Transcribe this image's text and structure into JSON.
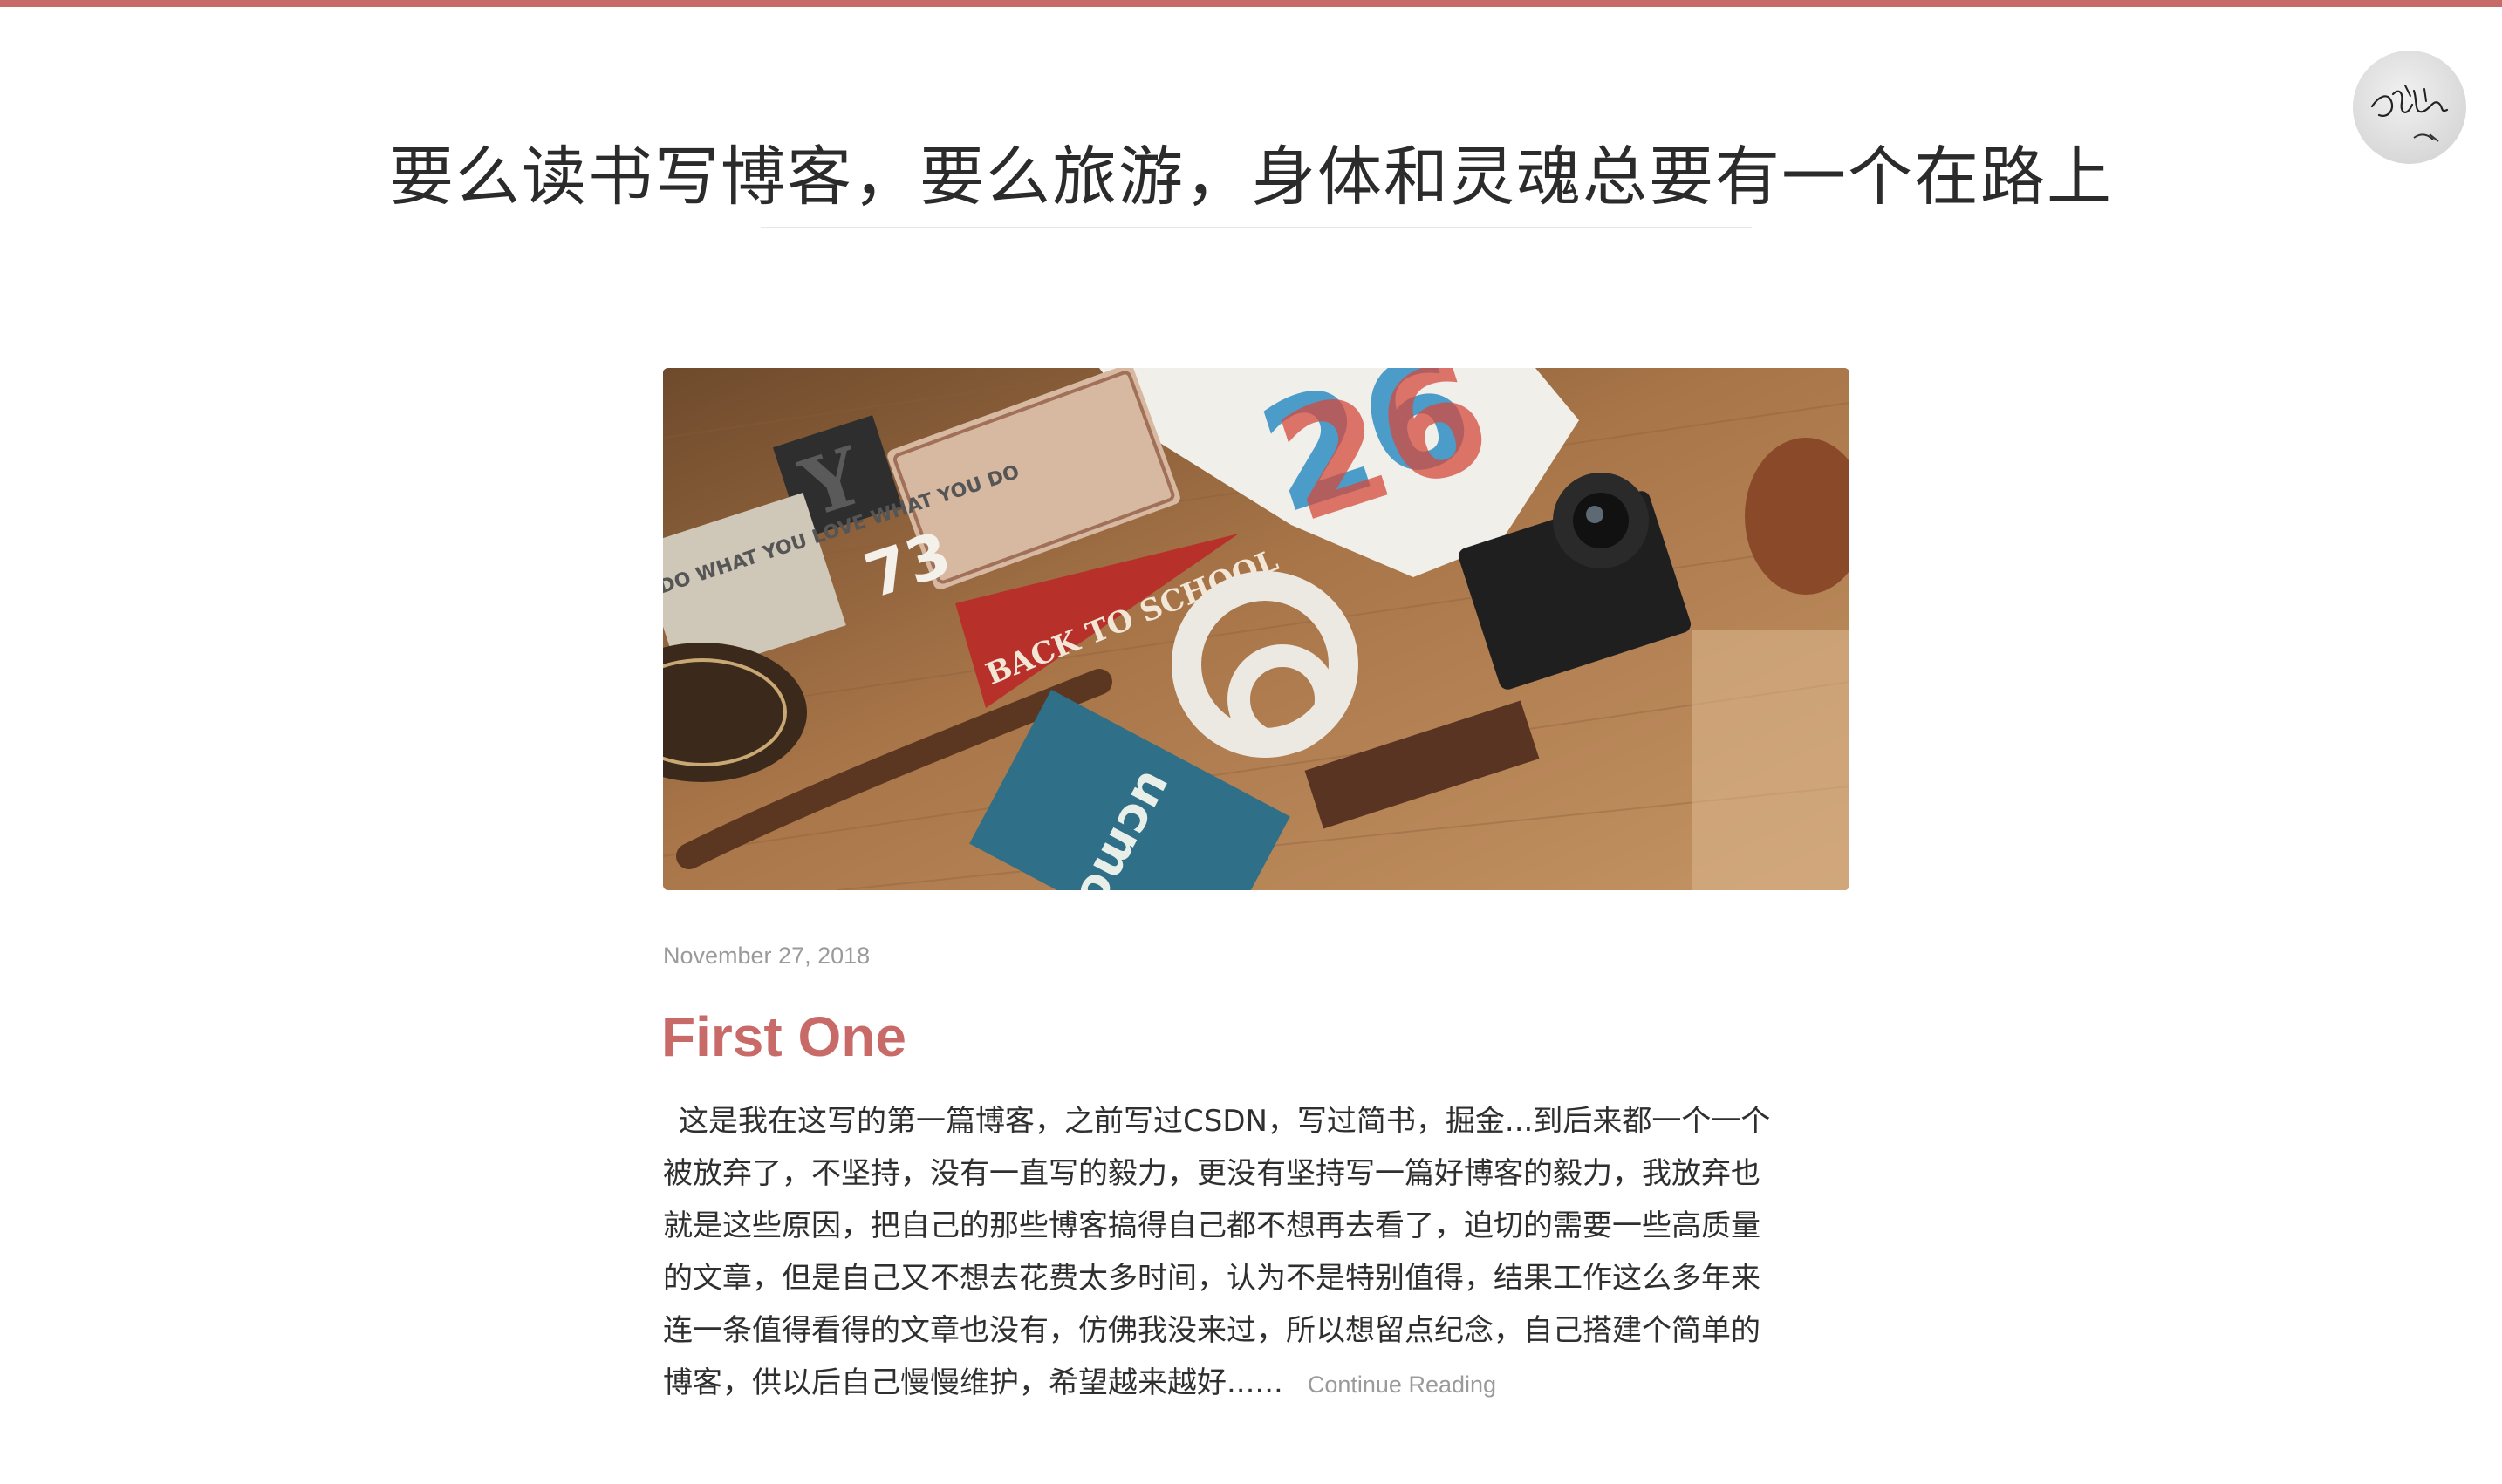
{
  "header": {
    "site_title": "要么读书写博客，要么旅游，身体和灵魂总要有一个在路上"
  },
  "post": {
    "date": "November 27, 2018",
    "title": "First One",
    "excerpt_lines": [
      "这是我在这写的第一篇博客，之前写过CSDN，写过简书，掘金...到后来都一个一个",
      "被放弃了，不坚持，没有一直写的毅力，更没有坚持写一篇好博客的毅力，我放弃也",
      "就是这些原因，把自己的那些博客搞得自己都不想再去看了，迫切的需要一些高质量",
      "的文章，但是自己又不想去花费太多时间，认为不是特别值得，结果工作这么多年来",
      "连一条值得看得的文章也没有，仿佛我没来过，所以想留点纪念，自己搭建个简单的",
      "博客，供以后自己慢慢维护，希望越来越好......"
    ],
    "continue_label": "Continue Reading",
    "cover_image_text": {
      "pennant": "BACK TO SCHOOL",
      "notebook": "DO WHAT YOU LOVE WHAT YOU DO",
      "badge": "ucmouu",
      "big_number": "26",
      "small_digits": "73"
    }
  },
  "colors": {
    "accent": "#c86a68",
    "meta_text": "#9a9a9a",
    "body_text": "#2f2f2f"
  }
}
